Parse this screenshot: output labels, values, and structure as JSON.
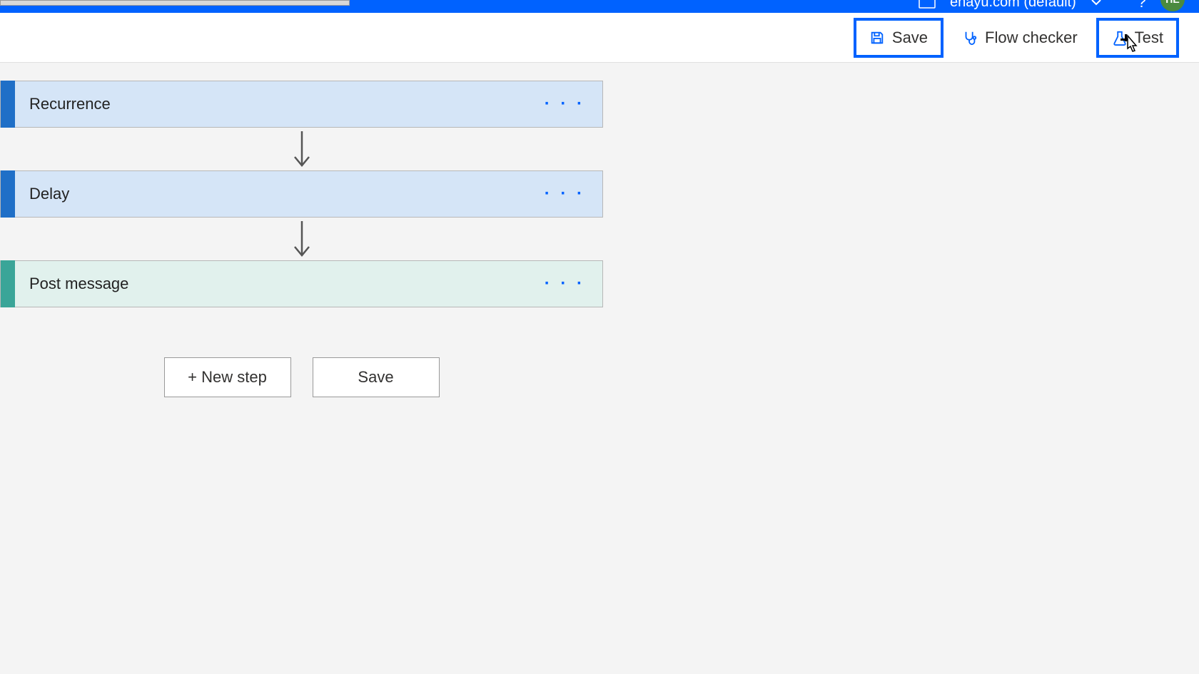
{
  "header": {
    "tenant_name": "enayu.com (default)",
    "avatar_initials": "HE"
  },
  "toolbar": {
    "save_label": "Save",
    "flow_checker_label": "Flow checker",
    "test_label": "Test"
  },
  "flow_steps": [
    {
      "label": "Recurrence",
      "style": "blue"
    },
    {
      "label": "Delay",
      "style": "blue"
    },
    {
      "label": "Post message",
      "style": "teal"
    }
  ],
  "actions": {
    "new_step_label": "+ New step",
    "save_label": "Save"
  }
}
